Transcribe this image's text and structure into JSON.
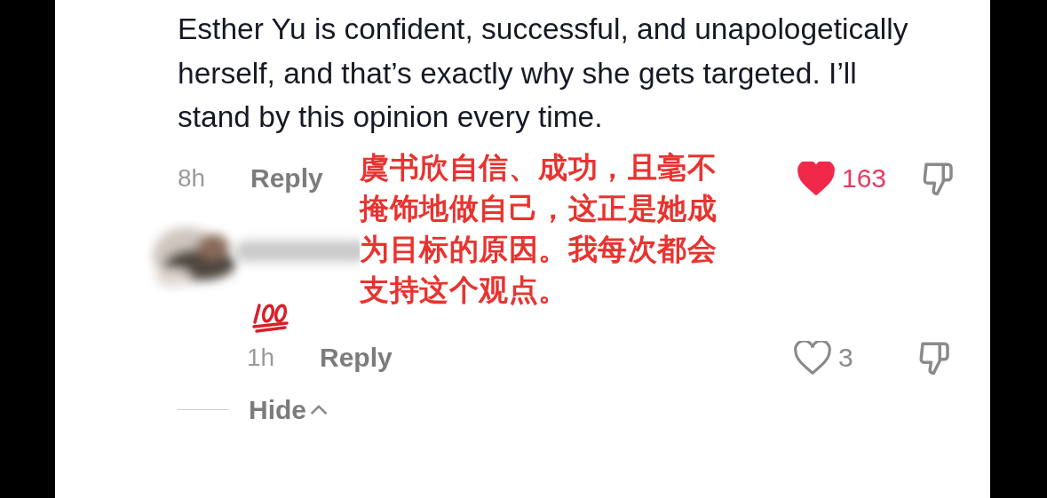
{
  "comment": {
    "text": "Esther Yu is confident, successful, and unapologetically herself, and that’s exactly why she gets targeted. I’ll stand by this opinion every time.",
    "time": "8h",
    "reply_label": "Reply",
    "liked": true,
    "likes": "163"
  },
  "replies": [
    {
      "time": "1h",
      "reply_label": "Reply",
      "liked": false,
      "likes": "3"
    }
  ],
  "hide_label": "Hide",
  "translation_overlay": "虞书欣自信、成功，且毫不掩饰地做自己，这正是她成为目标的原因。我每次都会支持这个观点。"
}
